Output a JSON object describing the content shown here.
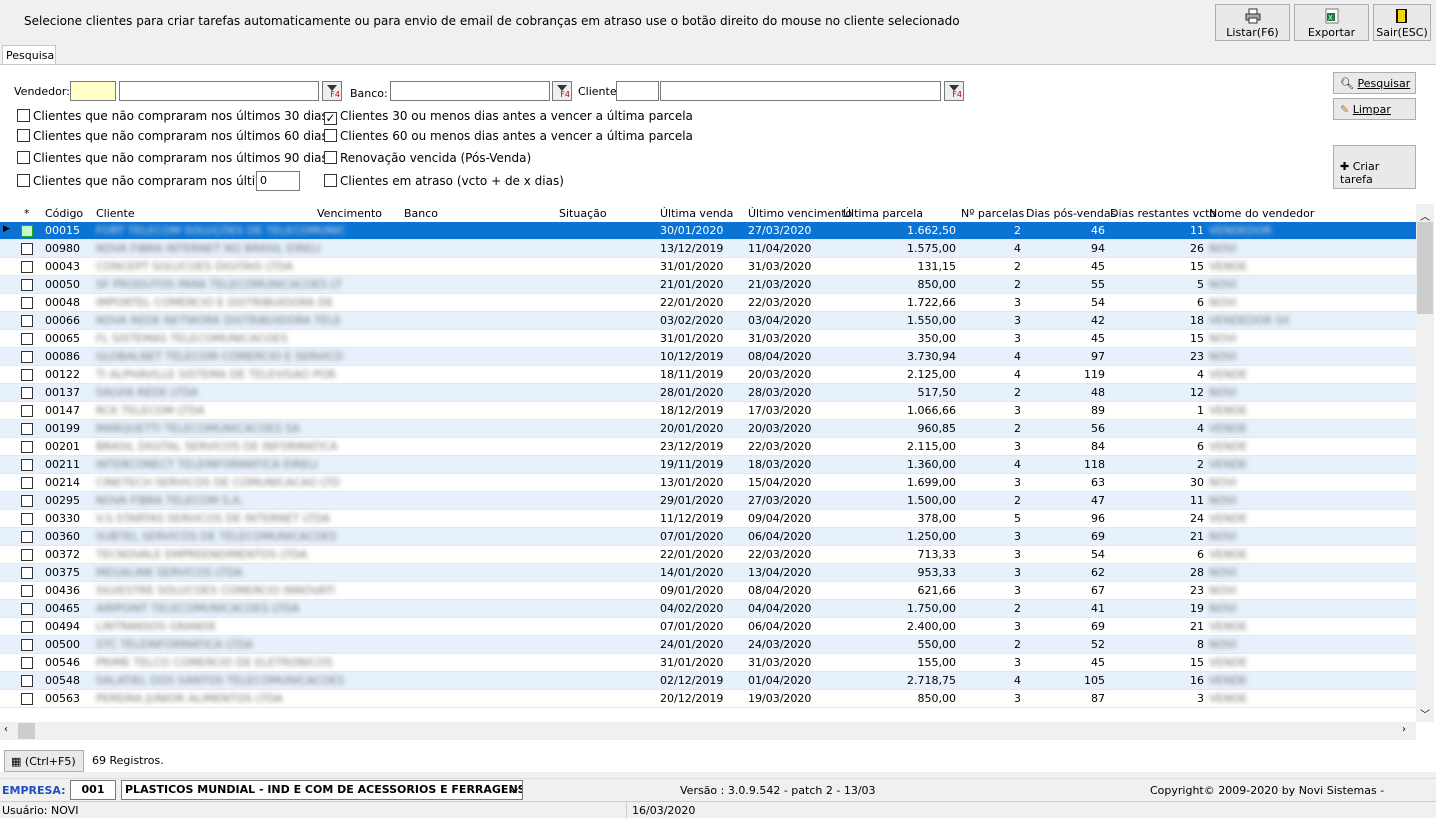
{
  "header": {
    "text": "Selecione clientes para criar tarefas automaticamente ou para envio de email de cobranças em atraso use o botão direito do mouse no cliente selecionado"
  },
  "toolbar": {
    "listar": "Listar(F6)",
    "exportar": "Exportar",
    "sair": "Sair(ESC)"
  },
  "tab": "Pesquisa",
  "filters": {
    "vendedor_label": "Vendedor:",
    "banco_label": "Banco:",
    "cliente_label": "Cliente:",
    "f4": "F4",
    "dias_value": "0",
    "left": [
      "Clientes que não compraram nos últimos 30 dias",
      "Clientes que não compraram nos últimos 60 dias",
      "Clientes que não compraram nos últimos 90 dias",
      "Clientes que não compraram nos últimos"
    ],
    "right": [
      "Clientes 30 ou menos dias antes a vencer a última parcela",
      "Clientes 60 ou menos dias antes a vencer a última parcela",
      "Renovação vencida (Pós-Venda)",
      "Clientes em atraso (vcto + de x dias)"
    ]
  },
  "buttons": {
    "pesquisar": "Pesquisar",
    "limpar": "Limpar",
    "criar": "Criar tarefa"
  },
  "grid": {
    "columns": [
      "*",
      "Código",
      "Cliente",
      "Vencimento",
      "Banco",
      "Situação",
      "Última venda",
      "Último vencimento",
      "Última parcela",
      "Nº parcelas",
      "Dias pós-vendas",
      "Dias restantes vcto",
      "Nome do vendedor"
    ],
    "rows": [
      [
        "00015",
        "FORT TELECOM SOLUÇÕES DE TELECOMUNIC",
        "30/01/2020",
        "27/03/2020",
        "1.662,50",
        "2",
        "46",
        "11",
        "VENDEDOR"
      ],
      [
        "00980",
        "NOVA FIBRA INTERNET NO BRASIL EIRELI",
        "13/12/2019",
        "11/04/2020",
        "1.575,00",
        "4",
        "94",
        "26",
        "NOVI"
      ],
      [
        "00043",
        "CONCEPT SOLUCOES DIGITAIS LTDA",
        "31/01/2020",
        "31/03/2020",
        "131,15",
        "2",
        "45",
        "15",
        "VENDE"
      ],
      [
        "00050",
        "SF PRODUTOS PARA TELECOMUNICACOES LT",
        "21/01/2020",
        "21/03/2020",
        "850,00",
        "2",
        "55",
        "5",
        "NOVI"
      ],
      [
        "00048",
        "IMPORTEL COMERCIO E DISTRIBUIDORA DE",
        "22/01/2020",
        "22/03/2020",
        "1.722,66",
        "3",
        "54",
        "6",
        "NOVI"
      ],
      [
        "00066",
        "NOVA REDE NETWORK DISTRIBUIDORA TELE",
        "03/02/2020",
        "03/04/2020",
        "1.550,00",
        "3",
        "42",
        "18",
        "VENDEDOR SILVA"
      ],
      [
        "00065",
        "FL SISTEMAS TELECOMUNICACOES",
        "31/01/2020",
        "31/03/2020",
        "350,00",
        "3",
        "45",
        "15",
        "NOVI"
      ],
      [
        "00086",
        "GLOBALNET TELECOM COMERCIO E SERVICO",
        "10/12/2019",
        "08/04/2020",
        "3.730,94",
        "4",
        "97",
        "23",
        "NOVI"
      ],
      [
        "00122",
        "TI ALPHAVILLE SISTEMA DE TELEVISAO POR",
        "18/11/2019",
        "20/03/2020",
        "2.125,00",
        "4",
        "119",
        "4",
        "VENDE"
      ],
      [
        "00137",
        "SALVIA REDE LTDA",
        "28/01/2020",
        "28/03/2020",
        "517,50",
        "2",
        "48",
        "12",
        "NOVI"
      ],
      [
        "00147",
        "RCK TELECOM LTDA",
        "18/12/2019",
        "17/03/2020",
        "1.066,66",
        "3",
        "89",
        "1",
        "VENDE"
      ],
      [
        "00199",
        "MARQUETTI TELECOMUNICACOES SA",
        "20/01/2020",
        "20/03/2020",
        "960,85",
        "2",
        "56",
        "4",
        "VENDE"
      ],
      [
        "00201",
        "BRASIL DIGITAL SERVICOS DE INFORMATICA",
        "23/12/2019",
        "22/03/2020",
        "2.115,00",
        "3",
        "84",
        "6",
        "VENDE"
      ],
      [
        "00211",
        "INTERCONECT TELEINFORMATICA EIRELI",
        "19/11/2019",
        "18/03/2020",
        "1.360,00",
        "4",
        "118",
        "2",
        "VENDE"
      ],
      [
        "00214",
        "CINETECH SERVICOS DE COMUNICACAO LTD",
        "13/01/2020",
        "15/04/2020",
        "1.699,00",
        "3",
        "63",
        "30",
        "NOVI"
      ],
      [
        "00295",
        "NOVA FIBRA TELECOM S.A.",
        "29/01/2020",
        "27/03/2020",
        "1.500,00",
        "2",
        "47",
        "11",
        "NOVI"
      ],
      [
        "00330",
        "V.S.STARTAS SERVICOS DE INTERNET LTDA",
        "11/12/2019",
        "09/04/2020",
        "378,00",
        "5",
        "96",
        "24",
        "VENDE"
      ],
      [
        "00360",
        "SUBTEL SERVICOS DE TELECOMUNICACOES",
        "07/01/2020",
        "06/04/2020",
        "1.250,00",
        "3",
        "69",
        "21",
        "NOVI"
      ],
      [
        "00372",
        "TECNOVALE EMPREENDIMENTOS LTDA",
        "22/01/2020",
        "22/03/2020",
        "713,33",
        "3",
        "54",
        "6",
        "VENDE"
      ],
      [
        "00375",
        "MEGALINK SERVICOS LTDA",
        "14/01/2020",
        "13/04/2020",
        "953,33",
        "3",
        "62",
        "28",
        "NOVI"
      ],
      [
        "00436",
        "SILVESTRE SOLUCOES COMERCIO INNOVATI",
        "09/01/2020",
        "08/04/2020",
        "621,66",
        "3",
        "67",
        "23",
        "NOVI"
      ],
      [
        "00465",
        "AIRPOINT TELECOMUNICACOES LTDA",
        "04/02/2020",
        "04/04/2020",
        "1.750,00",
        "2",
        "41",
        "19",
        "NOVI"
      ],
      [
        "00494",
        "LINTRANSOS GRANDE",
        "07/01/2020",
        "06/04/2020",
        "2.400,00",
        "3",
        "69",
        "21",
        "VENDE"
      ],
      [
        "00500",
        "STC TELEINFORMATICA LTDA",
        "24/01/2020",
        "24/03/2020",
        "550,00",
        "2",
        "52",
        "8",
        "NOVI"
      ],
      [
        "00546",
        "PRIME TELCO COMERCIO DE ELETRONICOS",
        "31/01/2020",
        "31/03/2020",
        "155,00",
        "3",
        "45",
        "15",
        "VENDE"
      ],
      [
        "00548",
        "SALATIEL DOS SANTOS TELECOMUNICACOES",
        "02/12/2019",
        "01/04/2020",
        "2.718,75",
        "4",
        "105",
        "16",
        "VENDE"
      ],
      [
        "00563",
        "PEREIRA JUNIOR ALIMENTOS LTDA",
        "20/12/2019",
        "19/03/2020",
        "850,00",
        "3",
        "87",
        "3",
        "VENDE"
      ]
    ]
  },
  "footer": {
    "ctrl_f5": "(Ctrl+F5)",
    "registros": "69 Registros.",
    "empresa_label": "EMPRESA:",
    "empresa_code": "001",
    "empresa_name": "PLASTICOS MUNDIAL - IND E COM DE ACESSORIOS E FERRAGENS P TE",
    "versao": "Versão : 3.0.9.542 - patch 2 -  13/03",
    "copyright": "Copyright© 2009-2020 by Novi Sistemas   -",
    "usuario": "Usuário: NOVI",
    "date": "16/03/2020"
  }
}
